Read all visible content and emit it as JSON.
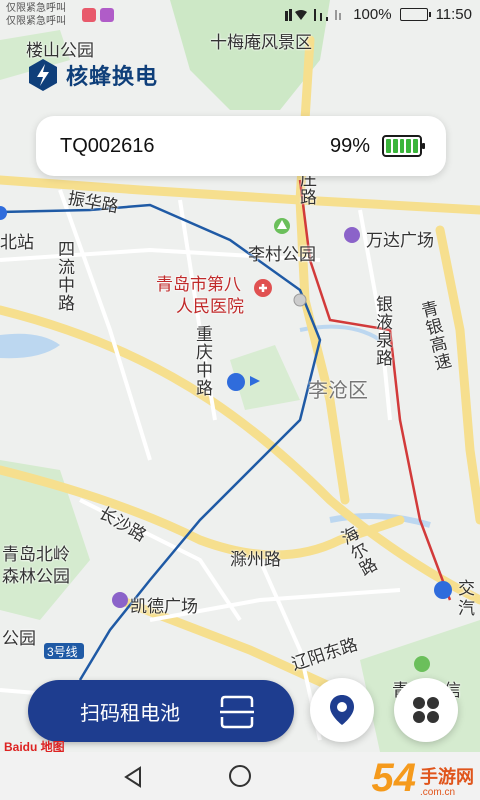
{
  "status_bar": {
    "carrier_line1": "仅限紧急呼叫",
    "carrier_line2": "仅限紧急呼叫",
    "battery": "100%",
    "time": "11:50",
    "battery_level": 1.0
  },
  "app": {
    "name": "核蜂换电"
  },
  "device_card": {
    "device_id": "TQ002616",
    "battery_percent": "99%",
    "battery_level": 0.99
  },
  "map": {
    "labels": {
      "loushan_park": "楼山公园",
      "shimeian": "十梅庵风景区",
      "zhenhua_rd": "振华路",
      "sifang_rd": "四流中路",
      "beizhan": "北站",
      "zhuang_rd": "庄路",
      "licun_park": "李村公园",
      "wanda": "万达广场",
      "hospital_1": "青岛市第八",
      "hospital_2": "人民医院",
      "yinye_rd": "银液泉路",
      "qingyin_hwy": "青银高速",
      "chongqing_rd": "重庆中路",
      "licang": "李沧区",
      "changsha_rd": "长沙路",
      "beiling_1": "青岛北岭",
      "beiling_2": "森林公园",
      "chuzhou_rd": "滁州路",
      "haier_rd": "海尔路",
      "kaide": "凯德广场",
      "park": "公园",
      "liaoyang_rd": "辽阳东路",
      "line3": "3号线",
      "jiao": "交",
      "qi": "汽",
      "qingxin": "青",
      "xin": "信",
      "baidu": "Baidu 地图"
    },
    "colors": {
      "metro_blue": "#1f5aa5",
      "metro_red": "#d23a3a",
      "road_yellow": "#f6df8e",
      "park_green": "#cde8c6"
    }
  },
  "actions": {
    "scan_rent_label": "扫码租电池"
  },
  "watermark": {
    "big": "54",
    "cn": "手游网",
    "url": ".com.cn"
  }
}
